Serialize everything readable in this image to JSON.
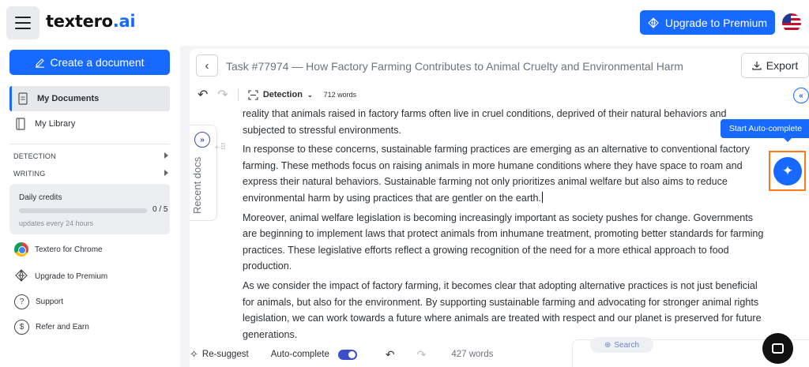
{
  "header": {
    "logo_text": "textero",
    "logo_suffix": ".ai",
    "upgrade_label": "Upgrade to Premium"
  },
  "sidebar": {
    "create_label": "Create a document",
    "items": [
      {
        "label": "My Documents",
        "icon": "document-icon"
      },
      {
        "label": "My Library",
        "icon": "library-icon"
      }
    ],
    "sections": [
      {
        "label": "DETECTION"
      },
      {
        "label": "WRITING"
      }
    ],
    "credits": {
      "title": "Daily credits",
      "count": "0 / 5",
      "used_fraction": 0,
      "subtitle": "updates every 24 hours"
    },
    "links": [
      {
        "label": "Textero for Chrome",
        "icon": "chrome-icon"
      },
      {
        "label": "Upgrade to Premium",
        "icon": "diamond-icon"
      },
      {
        "label": "Support",
        "icon": "question-icon"
      },
      {
        "label": "Refer and Earn",
        "icon": "dollar-icon"
      }
    ]
  },
  "document": {
    "title": "Task #77974 — How Factory Farming Contributes to Animal Cruelty and Environmental Harm",
    "export_label": "Export",
    "toolbar": {
      "mode_label": "Detection",
      "word_count": "712 words"
    },
    "recent_docs_label": "Recent docs",
    "paragraphs": [
      "reality that animals raised in factory farms often live in cruel conditions, deprived of their natural behaviors and subjected to stressful environments.",
      "In response to these concerns, sustainable farming practices are emerging as an alternative to conventional factory farming. These methods focus on raising animals in more humane conditions where they have space to roam and express their natural behaviors. Sustainable farming not only prioritizes animal welfare but also aims to reduce environmental harm by using practices that are gentler on the earth.",
      "Moreover, animal welfare legislation is becoming increasingly important as society pushes for change. Governments are beginning to implement laws that protect animals from inhumane treatment, promoting better standards for farming practices. These legislative efforts reflect a growing recognition of the need for a more ethical approach to food production.",
      "As we consider the impact of factory farming, it becomes clear that adopting alternative practices is not just beneficial for animals, but also for the environment. By supporting sustainable farming and advocating for stronger animal rights legislation, we can work towards a future where animals are treated with respect and our planet is preserved for future generations."
    ],
    "autocomplete_tooltip": "Start Auto-complete",
    "bottom_bar": {
      "resuggest_label": "Re-suggest",
      "autocomplete_label": "Auto-complete",
      "autocomplete_on": true,
      "word_count": "427 words"
    },
    "search_label": "Search"
  },
  "colors": {
    "accent": "#1769ff",
    "highlight_box": "#ff7a1a"
  }
}
